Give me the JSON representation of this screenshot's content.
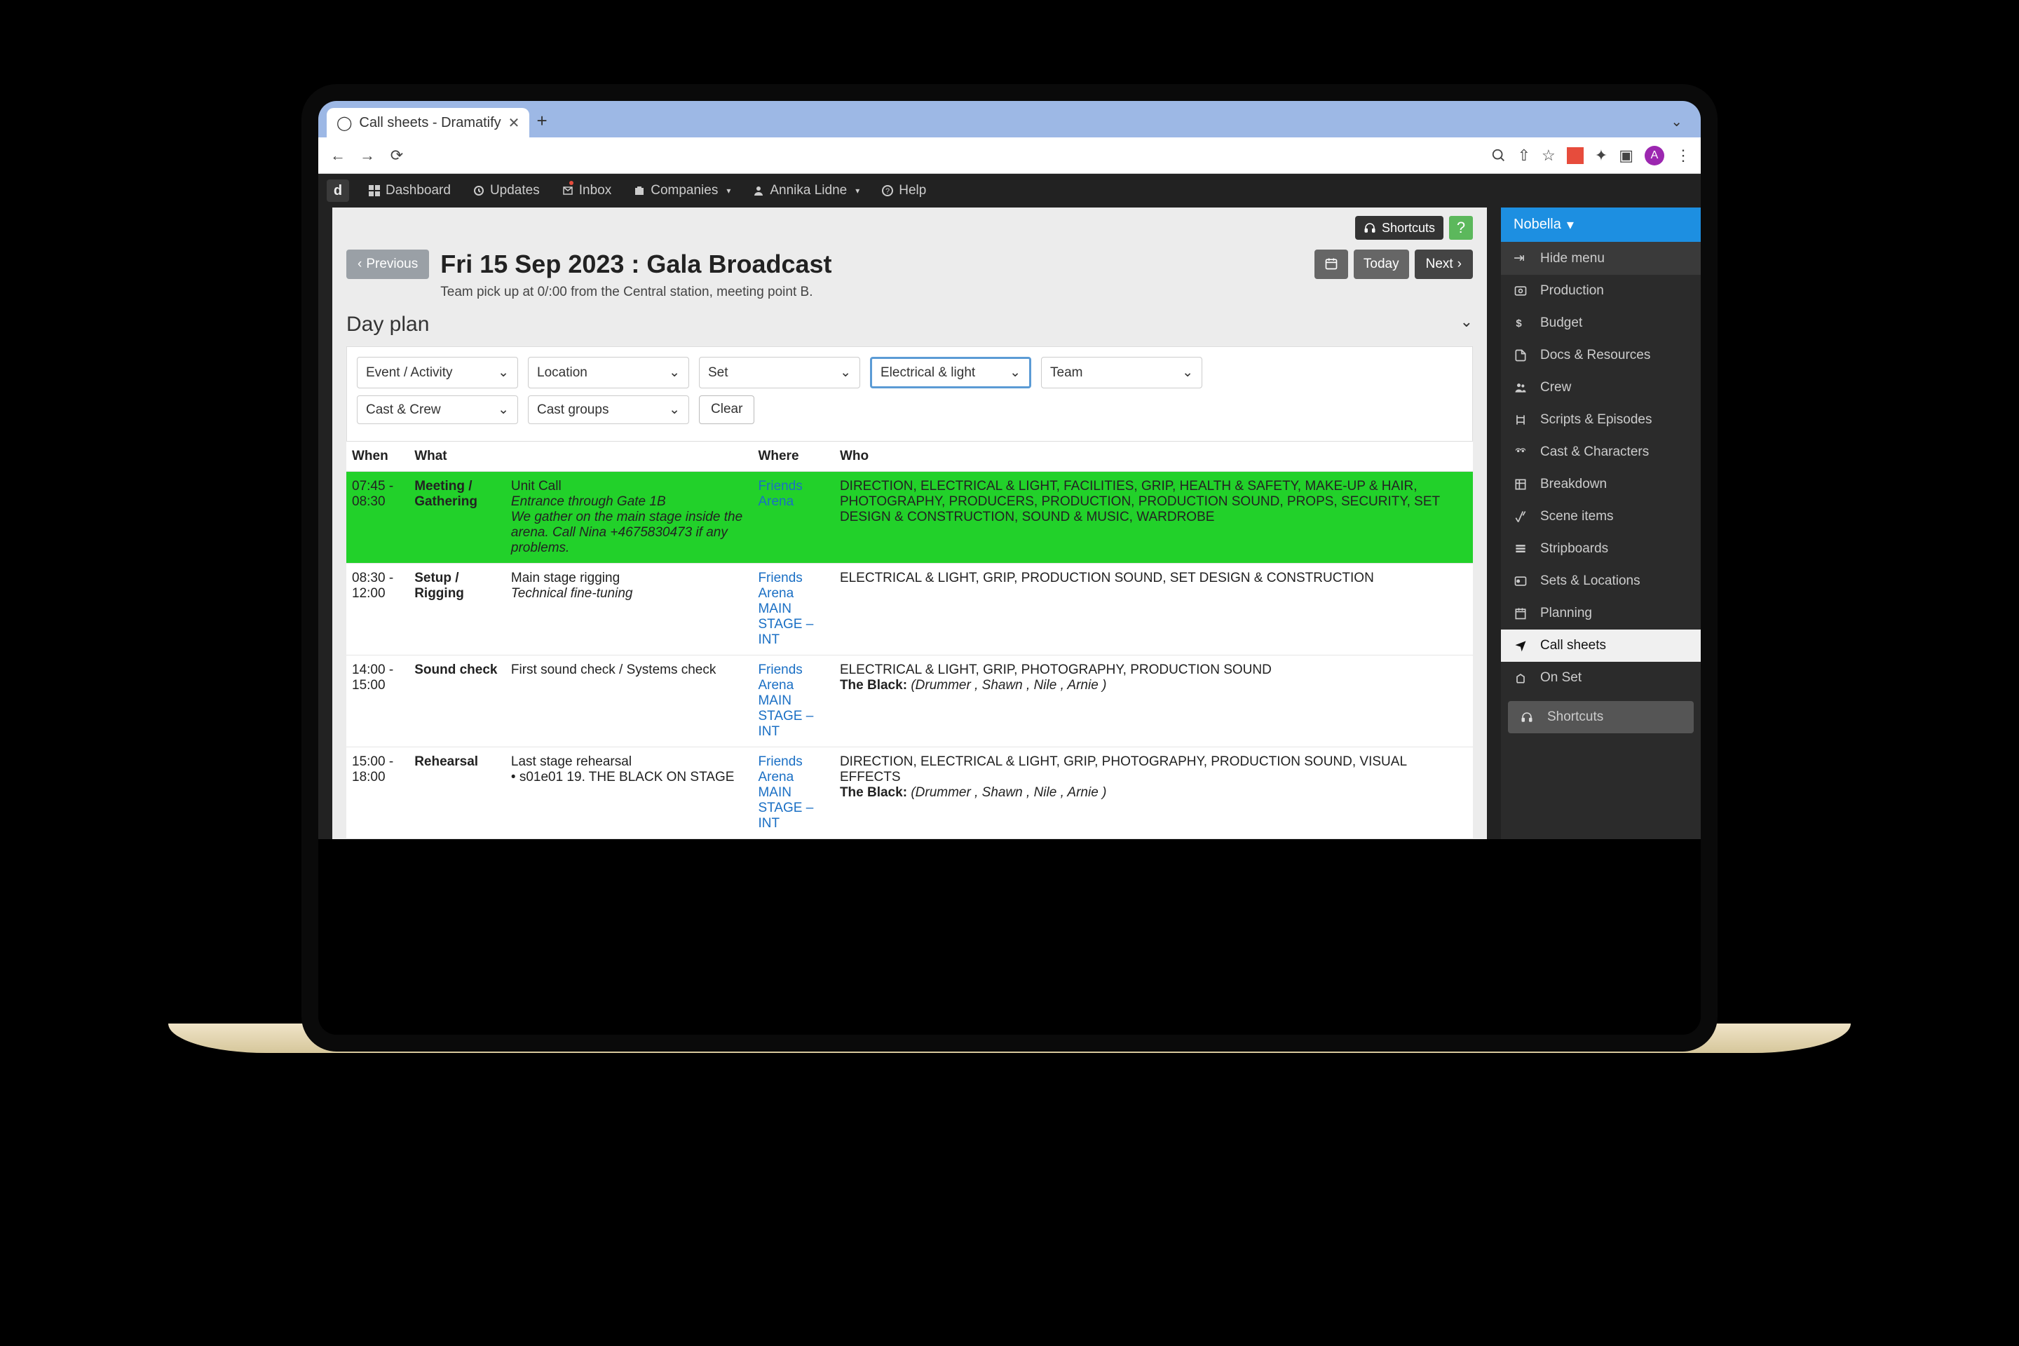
{
  "browser": {
    "tab_title": "Call sheets - Dramatify",
    "avatar_letter": "A"
  },
  "topnav": {
    "logo": "d",
    "items": [
      {
        "label": "Dashboard"
      },
      {
        "label": "Updates"
      },
      {
        "label": "Inbox"
      },
      {
        "label": "Companies"
      },
      {
        "label": "Annika Lidne"
      },
      {
        "label": "Help"
      }
    ]
  },
  "toolbar": {
    "shortcuts": "Shortcuts",
    "help_q": "?"
  },
  "page": {
    "previous": "Previous",
    "title": "Fri 15 Sep 2023 : Gala Broadcast",
    "subtitle": "Team pick up at 0/:00 from the Central station, meeting point B.",
    "today": "Today",
    "next": "Next"
  },
  "section_heading": "Day plan",
  "filters": {
    "row1": [
      "Event / Activity",
      "Location",
      "Set",
      "Electrical & light",
      "Team"
    ],
    "active_index": 3,
    "row2": [
      "Cast & Crew",
      "Cast groups"
    ],
    "clear": "Clear"
  },
  "columns": [
    "When",
    "What",
    "",
    "Where",
    "Who"
  ],
  "rows": [
    {
      "highlight": true,
      "when": "07:45 - 08:30",
      "what": "Meeting / Gathering",
      "detail_title": "Unit Call",
      "detail_lines": [
        "Entrance through Gate 1B",
        "We gather on the main stage inside the arena. Call Nina +4675830473 if any problems."
      ],
      "where": "Friends Arena",
      "who": "DIRECTION, ELECTRICAL & LIGHT, FACILITIES, GRIP, HEALTH & SAFETY, MAKE-UP & HAIR, PHOTOGRAPHY, PRODUCERS, PRODUCTION, PRODUCTION SOUND, PROPS, SECURITY, SET DESIGN & CONSTRUCTION, SOUND & MUSIC, WARDROBE"
    },
    {
      "highlight": false,
      "when": "08:30 - 12:00",
      "what": "Setup / Rigging",
      "detail_title": "Main stage rigging",
      "detail_lines": [
        "Technical fine-tuning"
      ],
      "where": "Friends Arena\nMAIN STAGE – INT",
      "who": "ELECTRICAL & LIGHT, GRIP, PRODUCTION SOUND, SET DESIGN & CONSTRUCTION"
    },
    {
      "highlight": false,
      "when": "14:00 - 15:00",
      "what": "Sound check",
      "detail_title": "First sound check / Systems check",
      "detail_lines": [],
      "where": "Friends Arena\nMAIN STAGE – INT",
      "who": "ELECTRICAL & LIGHT, GRIP, PHOTOGRAPHY, PRODUCTION SOUND",
      "cast_label": "The Black:",
      "cast": "(Drummer , Shawn , Nile , Arnie )"
    },
    {
      "highlight": false,
      "when": "15:00 - 18:00",
      "what": "Rehearsal",
      "detail_title": "Last stage rehearsal",
      "bullet": "s01e01 19. THE BLACK ON STAGE",
      "where": "Friends Arena\nMAIN STAGE – INT",
      "who": "DIRECTION, ELECTRICAL & LIGHT, GRIP, PHOTOGRAPHY, PRODUCTION SOUND, VISUAL EFFECTS",
      "cast_label": "The Black:",
      "cast": "(Drummer , Shawn , Nile , Arnie )"
    }
  ],
  "sidebar": {
    "project": "Nobella",
    "hide": "Hide menu",
    "items": [
      "Production",
      "Budget",
      "Docs & Resources",
      "Crew",
      "Scripts & Episodes",
      "Cast & Characters",
      "Breakdown",
      "Scene items",
      "Stripboards",
      "Sets & Locations",
      "Planning",
      "Call sheets",
      "On Set"
    ],
    "active_index": 11,
    "shortcuts": "Shortcuts"
  }
}
